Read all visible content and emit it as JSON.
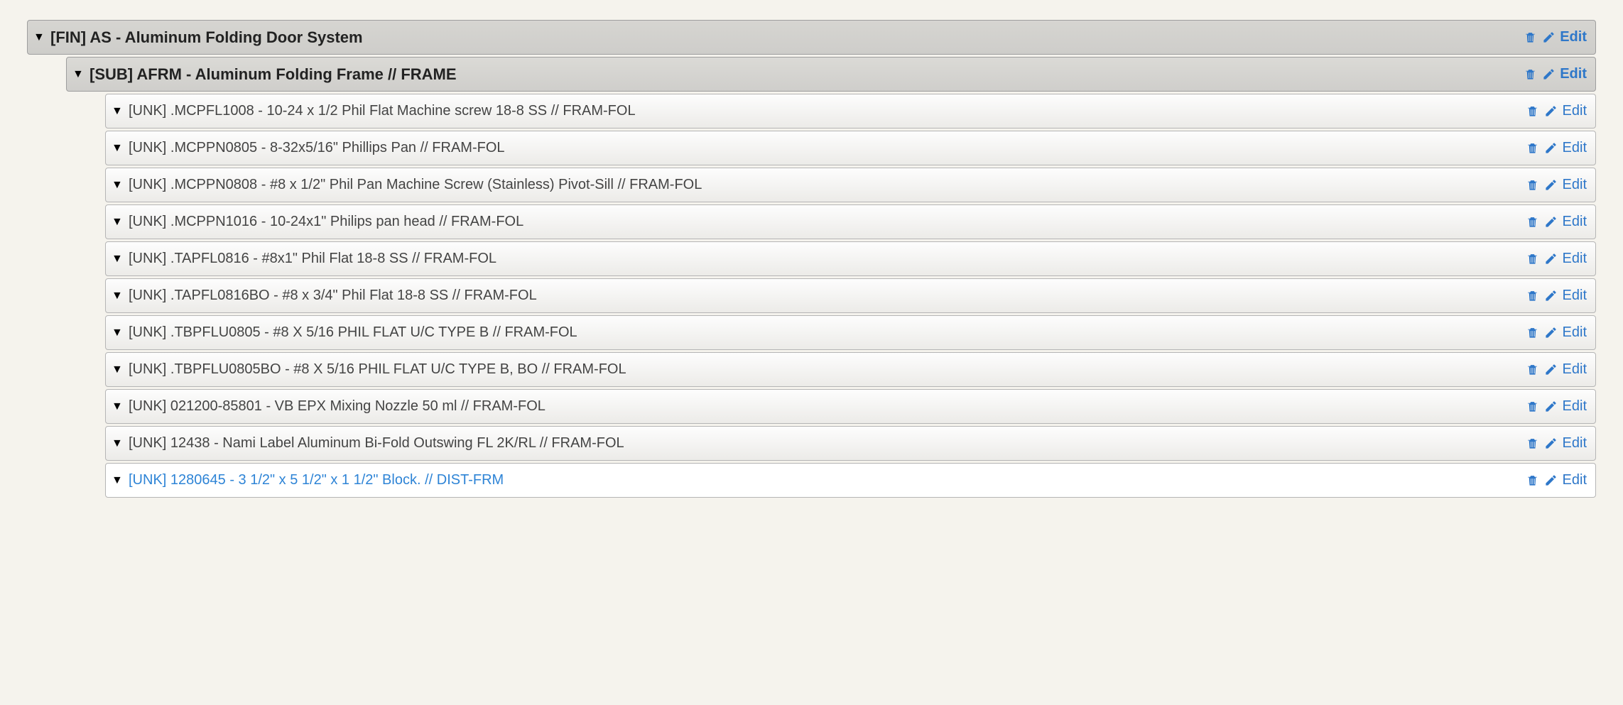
{
  "edit_label": "Edit",
  "rows": [
    {
      "level": 0,
      "style": "header-primary",
      "selected": false,
      "label": "[FIN] AS - Aluminum Folding Door System"
    },
    {
      "level": 1,
      "style": "header-secondary",
      "selected": false,
      "label": "[SUB] AFRM - Aluminum Folding Frame // FRAME"
    },
    {
      "level": 2,
      "style": "item",
      "selected": false,
      "label": "[UNK] .MCPFL1008 - 10-24 x 1/2 Phil Flat Machine screw 18-8 SS // FRAM-FOL"
    },
    {
      "level": 2,
      "style": "item",
      "selected": false,
      "label": "[UNK] .MCPPN0805 - 8-32x5/16\" Phillips Pan // FRAM-FOL"
    },
    {
      "level": 2,
      "style": "item",
      "selected": false,
      "label": "[UNK] .MCPPN0808 - #8 x 1/2\" Phil Pan Machine Screw (Stainless) Pivot-Sill // FRAM-FOL"
    },
    {
      "level": 2,
      "style": "item",
      "selected": false,
      "label": "[UNK] .MCPPN1016 - 10-24x1\" Philips pan head // FRAM-FOL"
    },
    {
      "level": 2,
      "style": "item",
      "selected": false,
      "label": "[UNK] .TAPFL0816 - #8x1\" Phil Flat 18-8 SS // FRAM-FOL"
    },
    {
      "level": 2,
      "style": "item",
      "selected": false,
      "label": "[UNK] .TAPFL0816BO - #8 x 3/4\" Phil Flat 18-8 SS // FRAM-FOL"
    },
    {
      "level": 2,
      "style": "item",
      "selected": false,
      "label": "[UNK] .TBPFLU0805 - #8 X 5/16 PHIL FLAT U/C TYPE B // FRAM-FOL"
    },
    {
      "level": 2,
      "style": "item",
      "selected": false,
      "label": "[UNK] .TBPFLU0805BO - #8 X 5/16 PHIL FLAT U/C TYPE B, BO // FRAM-FOL"
    },
    {
      "level": 2,
      "style": "item",
      "selected": false,
      "label": "[UNK] 021200-85801 - VB EPX Mixing Nozzle 50 ml // FRAM-FOL"
    },
    {
      "level": 2,
      "style": "item",
      "selected": false,
      "label": "[UNK] 12438 - Nami Label Aluminum Bi-Fold Outswing FL 2K/RL // FRAM-FOL"
    },
    {
      "level": 2,
      "style": "item",
      "selected": true,
      "label": "[UNK] 1280645 - 3 1/2\" x 5 1/2\" x 1 1/2\" Block. // DIST-FRM"
    }
  ]
}
